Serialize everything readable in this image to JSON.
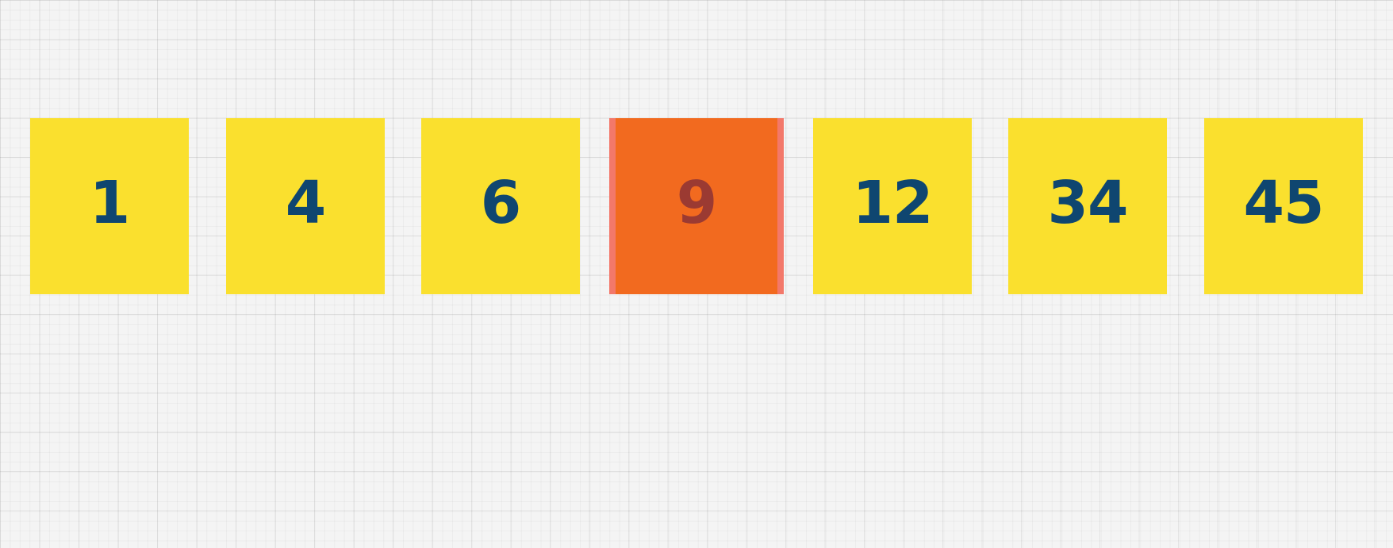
{
  "array": {
    "cells": [
      {
        "value": "1",
        "state": "normal"
      },
      {
        "value": "4",
        "state": "normal"
      },
      {
        "value": "6",
        "state": "normal"
      },
      {
        "value": "9",
        "state": "highlight"
      },
      {
        "value": "12",
        "state": "normal"
      },
      {
        "value": "34",
        "state": "normal"
      },
      {
        "value": "45",
        "state": "normal"
      }
    ]
  },
  "colors": {
    "cell_fill": "#fae02e",
    "cell_text": "#0f4670",
    "highlight_fill": "#f26a1f",
    "highlight_edge": "#f3786a",
    "highlight_text": "#9b3a32",
    "background": "#f4f4f4"
  }
}
